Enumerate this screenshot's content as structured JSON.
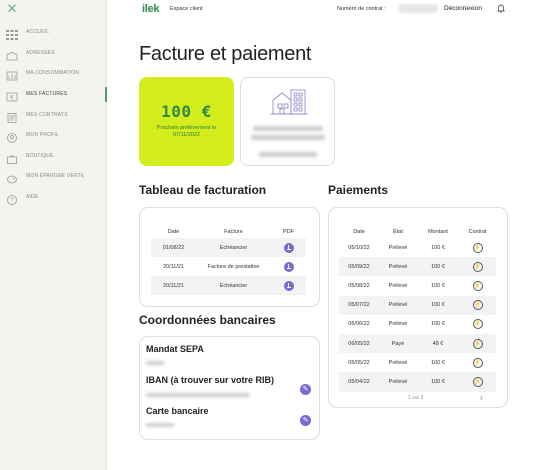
{
  "nav": {
    "items": [
      {
        "label": "ACCUEIL",
        "icon": "grid-icon"
      },
      {
        "label": "ADRESSES",
        "icon": "home-icon"
      },
      {
        "label": "MA CONSOMMATION",
        "icon": "chart-icon"
      },
      {
        "label": "MES FACTURES",
        "icon": "euro-icon"
      },
      {
        "label": "MES CONTRATS",
        "icon": "document-icon"
      },
      {
        "label": "MON PROFIL",
        "icon": "profile-icon"
      },
      {
        "label": "BOUTIQUE",
        "icon": "shop-icon"
      },
      {
        "label": "MON ÉPARGNE VERTE",
        "icon": "savings-icon"
      },
      {
        "label": "AIDE",
        "icon": "help-icon"
      }
    ],
    "active_index": 3
  },
  "header": {
    "logo": "ilek",
    "app_name": "Espace client",
    "contract_label": "Numéro de contrat :",
    "logout": "Déconnexion"
  },
  "page_title": "Facture et paiement",
  "next_payment": {
    "amount": "100 €",
    "label": "Prochain prélèvement le 07/11/2022"
  },
  "billing": {
    "title": "Tableau de facturation",
    "columns": [
      "Date",
      "Facture",
      "PDF"
    ],
    "rows": [
      {
        "date": "01/08/22",
        "facture": "Echéancier"
      },
      {
        "date": "20/11/21",
        "facture": "Facture de prestation"
      },
      {
        "date": "20/11/21",
        "facture": "Echéancier"
      }
    ]
  },
  "payments": {
    "title": "Paiements",
    "columns": [
      "Date",
      "État",
      "Montant",
      "Contrat"
    ],
    "rows": [
      {
        "date": "05/10/22",
        "etat": "Prélevé",
        "montant": "100 €"
      },
      {
        "date": "05/09/22",
        "etat": "Prélevé",
        "montant": "100 €"
      },
      {
        "date": "05/08/22",
        "etat": "Prélevé",
        "montant": "100 €"
      },
      {
        "date": "05/07/22",
        "etat": "Prélevé",
        "montant": "100 €"
      },
      {
        "date": "06/06/22",
        "etat": "Prélevé",
        "montant": "100 €"
      },
      {
        "date": "06/05/22",
        "etat": "Payé",
        "montant": "48 €"
      },
      {
        "date": "05/05/22",
        "etat": "Prélevé",
        "montant": "100 €"
      },
      {
        "date": "05/04/22",
        "etat": "Prélevé",
        "montant": "100 €"
      }
    ],
    "pager": "1 sur 3"
  },
  "bank": {
    "title": "Coordonnées bancaires",
    "mandat": "Mandat SEPA",
    "iban": "IBAN (à trouver sur votre RIB)",
    "card": "Carte bancaire"
  },
  "colors": {
    "accent_green": "#2e8b4a",
    "lime": "#d4ed1c",
    "purple": "#7b68d0"
  }
}
